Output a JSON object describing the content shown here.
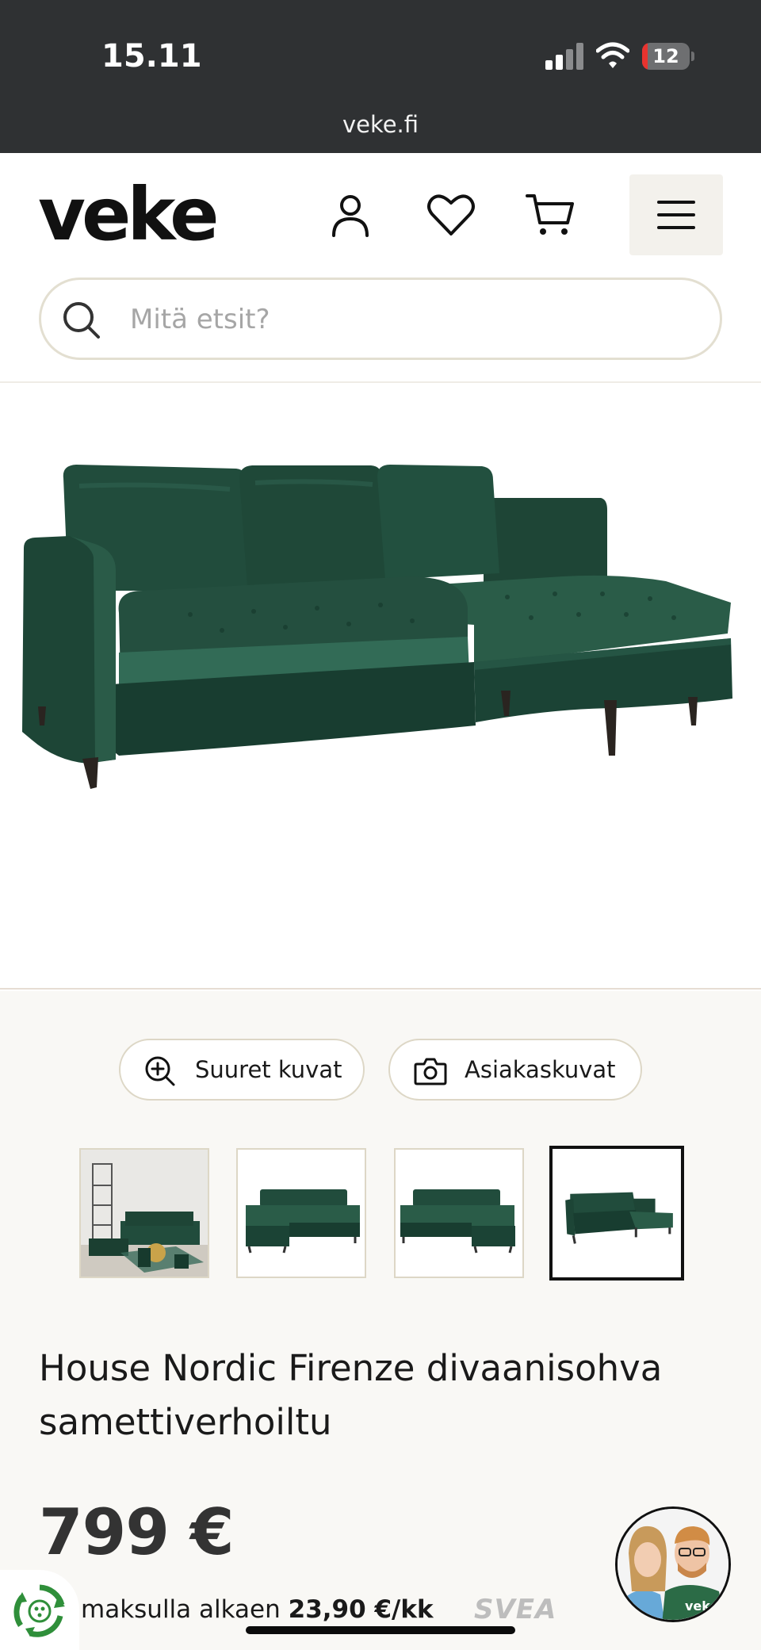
{
  "status_bar": {
    "time": "15.11",
    "battery": "12",
    "battery_level": 0.12,
    "url": "veke.fi"
  },
  "header": {
    "logo": "veke"
  },
  "search": {
    "placeholder": "Mitä etsit?"
  },
  "gallery": {
    "zoom_label": "Suuret kuvat",
    "customer_photos_label": "Asiakaskuvat",
    "thumbnails_count": 4,
    "active_thumbnail": 4
  },
  "product": {
    "title": "House Nordic Firenze divaanisohva samettiverhoiltu",
    "price": "799 €",
    "financing_prefix": "maksulla alkaen",
    "financing_amount": "23,90 €/kk",
    "financing_provider": "SVEA"
  },
  "colors": {
    "status_bar": "#2f3133",
    "sofa_green": "#1f4a3a",
    "accent_red": "#e8332f",
    "section_bg": "#f9f8f5"
  }
}
